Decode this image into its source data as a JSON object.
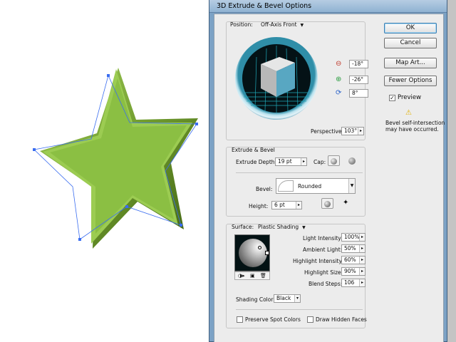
{
  "dialog": {
    "title": "3D Extrude & Bevel Options"
  },
  "buttons": {
    "ok": "OK",
    "cancel": "Cancel",
    "map_art": "Map Art...",
    "fewer_options": "Fewer Options"
  },
  "preview": {
    "label": "Preview",
    "checked": true
  },
  "warning": {
    "line1": "Bevel self-intersection",
    "line2": "may have occurred."
  },
  "position": {
    "label": "Position:",
    "value": "Off-Axis Front",
    "rot_x": "-18°",
    "rot_y": "-26°",
    "rot_z": "8°",
    "perspective_label": "Perspective:",
    "perspective": "103°"
  },
  "extrude": {
    "section_title": "Extrude & Bevel",
    "depth_label": "Extrude Depth:",
    "depth": "19 pt",
    "cap_label": "Cap:",
    "bevel_label": "Bevel:",
    "bevel": "Rounded",
    "height_label": "Height:",
    "height": "6 pt"
  },
  "surface": {
    "label": "Surface:",
    "value": "Plastic Shading",
    "light_intensity_label": "Light Intensity:",
    "light_intensity": "100%",
    "ambient_label": "Ambient Light:",
    "ambient": "50%",
    "highlight_intensity_label": "Highlight Intensity:",
    "highlight_intensity": "60%",
    "highlight_size_label": "Highlight Size:",
    "highlight_size": "90%",
    "blend_steps_label": "Blend Steps:",
    "blend_steps": "106",
    "shading_color_label": "Shading Color:",
    "shading_color": "Black"
  },
  "options": {
    "preserve_spot": "Preserve Spot Colors",
    "draw_hidden": "Draw Hidden Faces"
  },
  "colors": {
    "star_green": "#8bbf43",
    "selection_blue": "#3a6df0",
    "cube_side": "#58a7c2",
    "cube_top": "#e6e6e6",
    "warning": "#f0c020"
  }
}
